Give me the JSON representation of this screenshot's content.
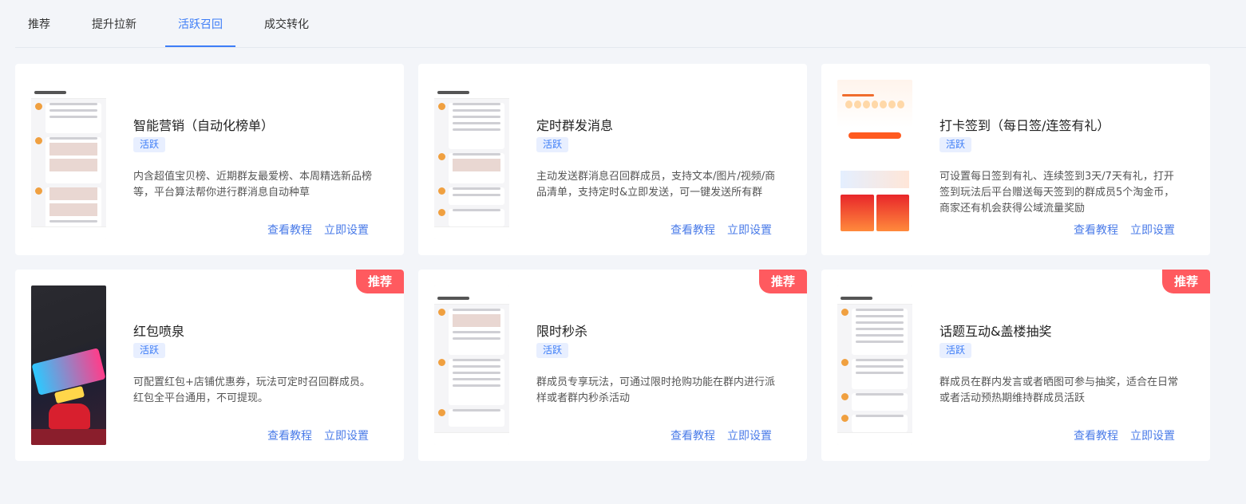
{
  "tabs": [
    {
      "label": "推荐"
    },
    {
      "label": "提升拉新"
    },
    {
      "label": "活跃召回",
      "active": true
    },
    {
      "label": "成交转化"
    }
  ],
  "accent_color": "#3d7df7",
  "badge_color": "#ff5a5f",
  "cards": [
    {
      "title": "智能营销（自动化榜单）",
      "tag": "活跃",
      "desc": "内含超值宝贝榜、近期群友最爱榜、本周精选新品榜等，平台算法帮你进行群消息自动种草",
      "tutorial": "查看教程",
      "setup": "立即设置",
      "badge": ""
    },
    {
      "title": "定时群发消息",
      "tag": "活跃",
      "desc": "主动发送群消息召回群成员，支持文本/图片/视频/商品清单，支持定时&立即发送，可一键发送所有群",
      "tutorial": "查看教程",
      "setup": "立即设置",
      "badge": ""
    },
    {
      "title": "打卡签到（每日签/连签有礼）",
      "tag": "活跃",
      "desc": "可设置每日签到有礼、连续签到3天/7天有礼，打开签到玩法后平台赠送每天签到的群成员5个淘金币，商家还有机会获得公域流量奖励",
      "tutorial": "查看教程",
      "setup": "立即设置",
      "badge": ""
    },
    {
      "title": "红包喷泉",
      "tag": "活跃",
      "desc": "可配置红包+店铺优惠券，玩法可定时召回群成员。红包全平台通用，不可提现。",
      "tutorial": "查看教程",
      "setup": "立即设置",
      "badge": "推荐"
    },
    {
      "title": "限时秒杀",
      "tag": "活跃",
      "desc": "群成员专享玩法，可通过限时抢购功能在群内进行派样或者群内秒杀活动",
      "tutorial": "查看教程",
      "setup": "立即设置",
      "badge": "推荐"
    },
    {
      "title": "话题互动&盖楼抽奖",
      "tag": "活跃",
      "desc": "群成员在群内发言或者晒图可参与抽奖，适合在日常或者活动预热期维持群成员活跃",
      "tutorial": "查看教程",
      "setup": "立即设置",
      "badge": "推荐"
    }
  ]
}
